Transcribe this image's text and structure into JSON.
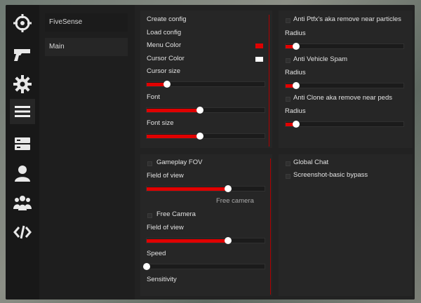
{
  "nav": {
    "icons": [
      "crosshair-icon",
      "gun-icon",
      "gear-icon",
      "menu-icon",
      "server-icon",
      "user-icon",
      "group-icon",
      "code-icon"
    ],
    "active": 3
  },
  "tabs": [
    {
      "label": "FiveSense"
    },
    {
      "label": "Main"
    }
  ],
  "panel_top_left": {
    "create_config": "Create config",
    "load_config": "Load config",
    "menu_color_label": "Menu Color",
    "menu_color": "#e00000",
    "cursor_color_label": "Cursor Color",
    "cursor_color": "#ffffff",
    "cursor_size_label": "Cursor size",
    "cursor_size_value": 0.17,
    "font_label": "Font",
    "font_value": 0.45,
    "font_size_label": "Font size",
    "font_size_value": 0.45
  },
  "panel_top_right": {
    "anti_ptfx_label": "Anti Ptfx's aka remove near particles",
    "radius1_label": "Radius",
    "radius1_value": 0.09,
    "anti_vehicle_label": "Anti Vehicle Spam",
    "radius2_label": "Radius",
    "radius2_value": 0.09,
    "anti_clone_label": "Anti Clone aka remove near peds",
    "radius3_label": "Radius",
    "radius3_value": 0.09
  },
  "panel_bottom_left": {
    "gameplay_fov_label": "Gameplay FOV",
    "fov1_label": "Field of view",
    "fov1_value": 0.69,
    "free_camera_heading": "Free camera",
    "free_camera_label": "Free Camera",
    "fov2_label": "Field of view",
    "fov2_value": 0.69,
    "speed_label": "Speed",
    "speed_value": 0.0,
    "sensitivity_label": "Sensitivity"
  },
  "panel_bottom_right": {
    "global_chat_label": "Global Chat",
    "screenshot_bypass_label": "Screenshot-basic bypass"
  },
  "colors": {
    "accent": "#e00000"
  }
}
